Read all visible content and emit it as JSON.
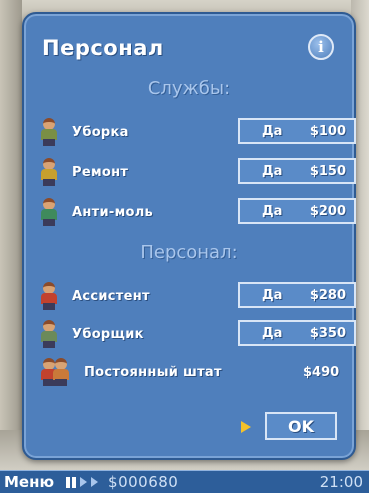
{
  "dialog": {
    "title": "Персонал",
    "info_icon": "i",
    "services_heading": "Службы:",
    "staff_heading": "Персонал:",
    "services": [
      {
        "label": "Уборка",
        "yes": "Да",
        "price": "$100",
        "shirt": "#7a8f45"
      },
      {
        "label": "Ремонт",
        "yes": "Да",
        "price": "$150",
        "shirt": "#c8a02e"
      },
      {
        "label": "Анти-моль",
        "yes": "Да",
        "price": "$200",
        "shirt": "#3f8a5c"
      }
    ],
    "staff": [
      {
        "label": "Ассистент",
        "yes": "Да",
        "price": "$280",
        "shirt": "#c2422e"
      },
      {
        "label": "Уборщик",
        "yes": "Да",
        "price": "$350",
        "shirt": "#6b8a5a"
      }
    ],
    "permanent": {
      "label": "Постоянный штат",
      "price": "$490"
    },
    "ok_label": "OK"
  },
  "statusbar": {
    "menu": "Меню",
    "money": "$000680",
    "time": "21:00"
  }
}
